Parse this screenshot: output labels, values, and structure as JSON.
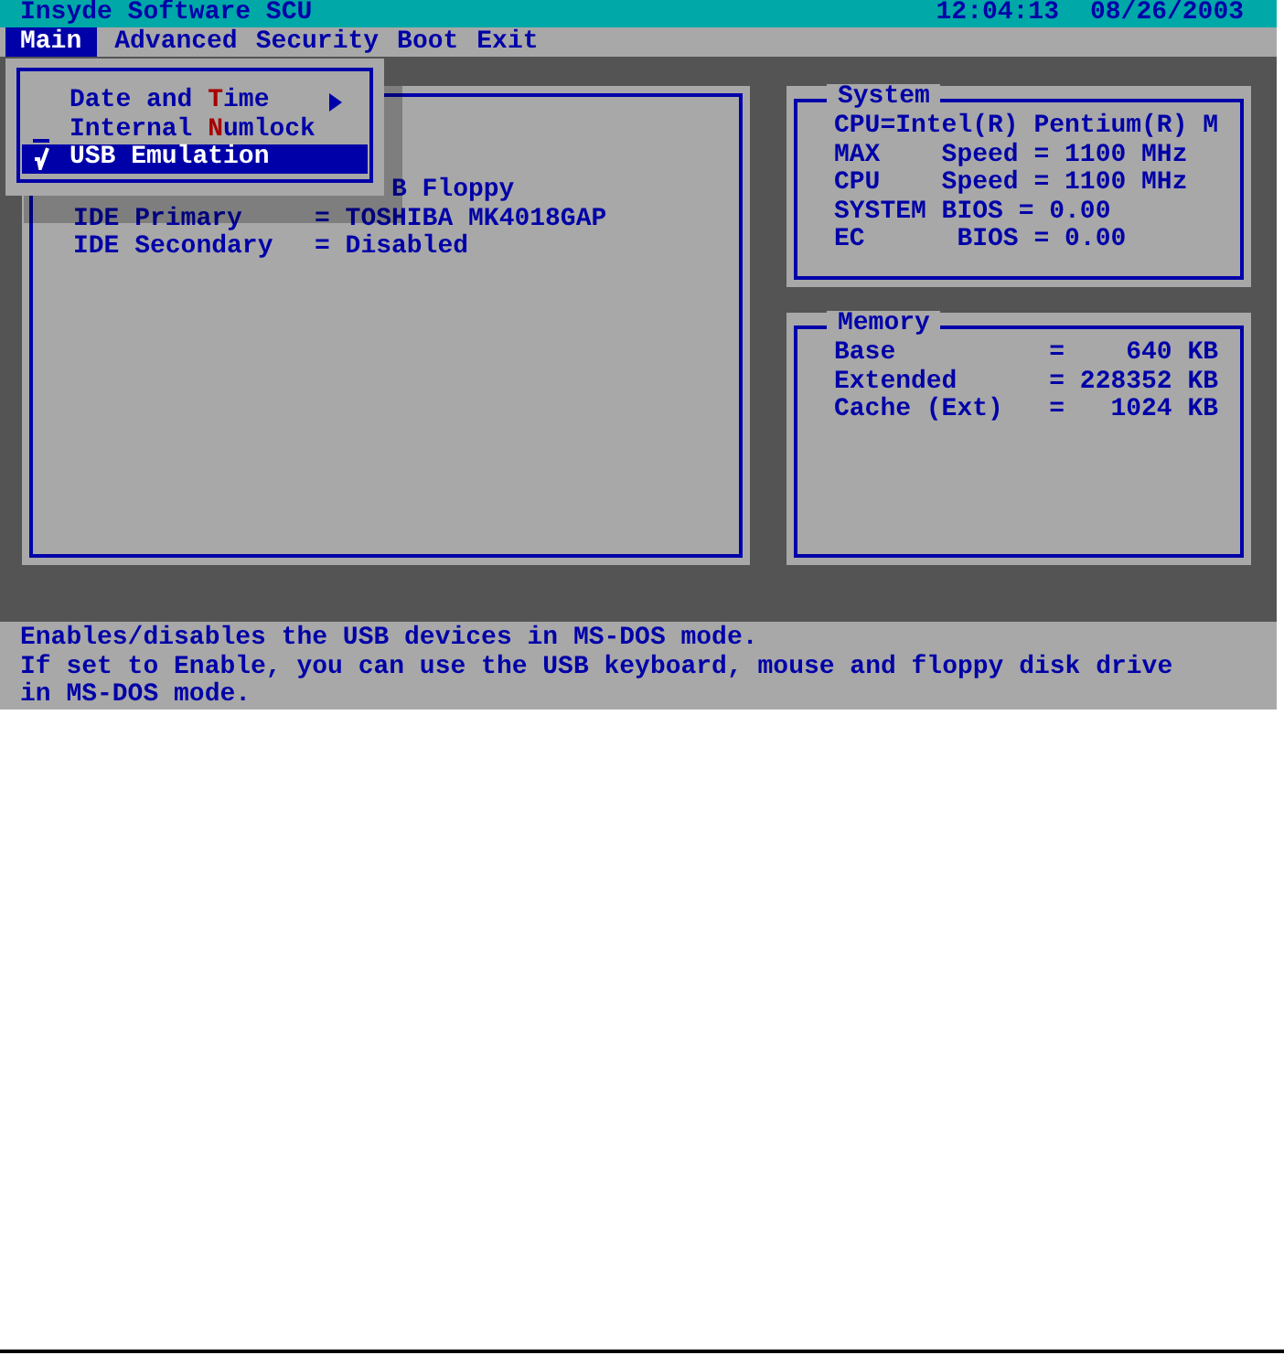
{
  "title_bar": {
    "title": "Insyde Software SCU",
    "time": "12:04:13",
    "date": "08/26/2003"
  },
  "menu_bar": [
    {
      "label": "Main",
      "selected": true
    },
    {
      "label": "Advanced",
      "selected": false
    },
    {
      "label": "Security",
      "selected": false
    },
    {
      "label": "Boot",
      "selected": false
    },
    {
      "label": "Exit",
      "selected": false
    }
  ],
  "dropdown": [
    {
      "kind": "submenu",
      "text_before": "Date and ",
      "hotkey": "T",
      "text_after": "ime",
      "selected": false
    },
    {
      "kind": "toggle",
      "checked": false,
      "text_before": "Internal ",
      "hotkey": "N",
      "text_after": "umlock",
      "selected": false
    },
    {
      "kind": "toggle",
      "checked": true,
      "text_before": "USB Emulation",
      "selected": true
    }
  ],
  "devices": [
    {
      "value": "B Floppy"
    },
    {
      "label": "IDE Primary",
      "value": "= TOSHIBA MK4018GAP"
    },
    {
      "label": "IDE Secondary",
      "value": "= Disabled"
    }
  ],
  "system": {
    "title": "System",
    "lines": [
      "CPU=Intel(R) Pentium(R) M",
      "MAX    Speed = 1100 MHz",
      "CPU    Speed = 1100 MHz",
      "SYSTEM BIOS = 0.00",
      "EC      BIOS = 0.00"
    ]
  },
  "memory": {
    "title": "Memory",
    "lines": [
      "Base          =    640 KB",
      "Extended      = 228352 KB",
      "Cache (Ext)   =   1024 KB"
    ]
  },
  "help": [
    "Enables/disables the USB devices in MS-DOS mode.",
    "If set to Enable, you can use the USB keyboard, mouse and floppy disk drive",
    "in MS-DOS mode."
  ]
}
